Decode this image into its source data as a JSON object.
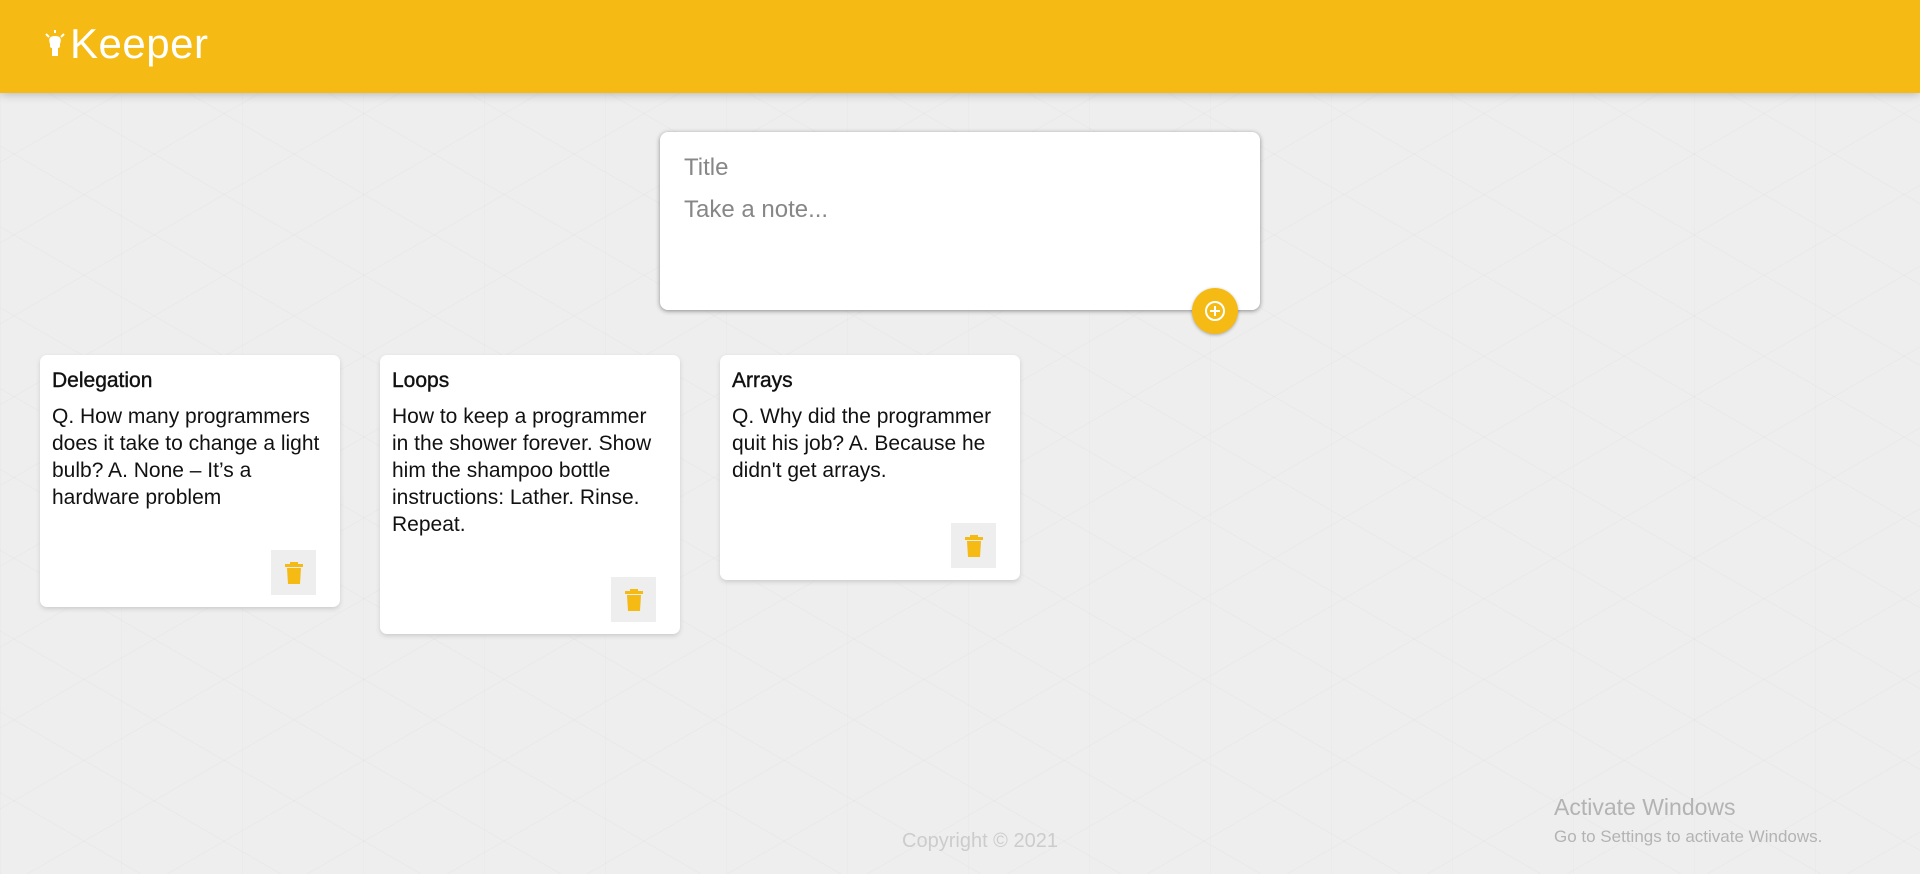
{
  "app": {
    "title": "Keeper",
    "brand_color": "#f5ba13",
    "logo_icon": "lightbulb-icon"
  },
  "create_note": {
    "title_placeholder": "Title",
    "content_placeholder": "Take a note...",
    "add_icon": "plus-icon"
  },
  "notes": [
    {
      "title": "Delegation",
      "content": "Q. How many programmers does it take to change a light bulb? A. None – It’s a hardware problem",
      "delete_icon": "trash-icon"
    },
    {
      "title": "Loops",
      "content": "How to keep a programmer in the shower forever. Show him the shampoo bottle instructions: Lather. Rinse. Repeat.",
      "delete_icon": "trash-icon"
    },
    {
      "title": "Arrays",
      "content": "Q. Why did the programmer quit his job? A. Because he didn't get arrays.",
      "delete_icon": "trash-icon"
    }
  ],
  "footer": {
    "copyright": "Copyright © 2021"
  },
  "windows_watermark": {
    "title": "Activate Windows",
    "subtitle": "Go to Settings to activate Windows."
  }
}
